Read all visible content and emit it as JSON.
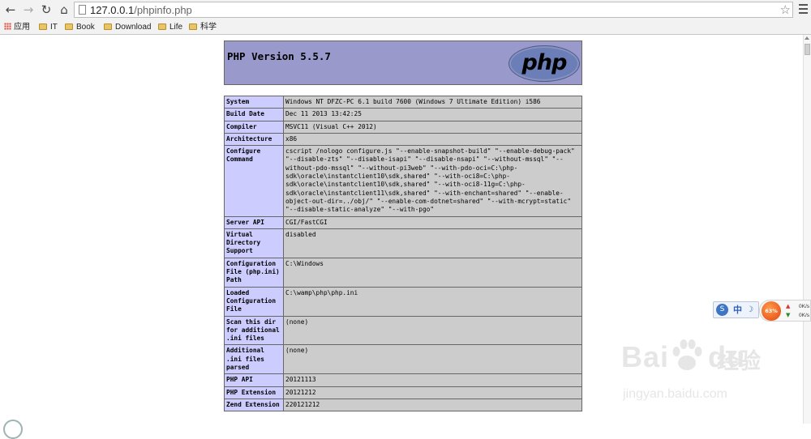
{
  "browser": {
    "url_host": "127.0.0.1",
    "url_path": "/phpinfo.php",
    "bookmarks": [
      {
        "label": "应用",
        "type": "apps"
      },
      {
        "label": "IT",
        "type": "folder"
      },
      {
        "label": "Book",
        "type": "folder"
      },
      {
        "label": "Download",
        "type": "folder"
      },
      {
        "label": "Life",
        "type": "folder"
      },
      {
        "label": "科学",
        "type": "folder"
      }
    ]
  },
  "phpinfo": {
    "version_title": "PHP Version 5.5.7",
    "logo_text": "php",
    "rows": [
      {
        "key": "System",
        "value": "Windows NT DFZC-PC 6.1 build 7600 (Windows 7 Ultimate Edition) i586"
      },
      {
        "key": "Build Date",
        "value": "Dec 11 2013 13:42:25"
      },
      {
        "key": "Compiler",
        "value": "MSVC11 (Visual C++ 2012)"
      },
      {
        "key": "Architecture",
        "value": "x86"
      },
      {
        "key": "Configure Command",
        "value": "cscript /nologo configure.js \"--enable-snapshot-build\" \"--enable-debug-pack\" \"--disable-zts\" \"--disable-isapi\" \"--disable-nsapi\" \"--without-mssql\" \"--without-pdo-mssql\" \"--without-pi3web\" \"--with-pdo-oci=C:\\php-sdk\\oracle\\instantclient10\\sdk,shared\" \"--with-oci8=C:\\php-sdk\\oracle\\instantclient10\\sdk,shared\" \"--with-oci8-11g=C:\\php-sdk\\oracle\\instantclient11\\sdk,shared\" \"--with-enchant=shared\" \"--enable-object-out-dir=../obj/\" \"--enable-com-dotnet=shared\" \"--with-mcrypt=static\" \"--disable-static-analyze\" \"--with-pgo\""
      },
      {
        "key": "Server API",
        "value": "CGI/FastCGI"
      },
      {
        "key": "Virtual Directory Support",
        "value": "disabled"
      },
      {
        "key": "Configuration File (php.ini) Path",
        "value": "C:\\Windows"
      },
      {
        "key": "Loaded Configuration File",
        "value": "C:\\wamp\\php\\php.ini"
      },
      {
        "key": "Scan this dir for additional .ini files",
        "value": "(none)"
      },
      {
        "key": "Additional .ini files parsed",
        "value": "(none)"
      },
      {
        "key": "PHP API",
        "value": "20121113"
      },
      {
        "key": "PHP Extension",
        "value": "20121212"
      },
      {
        "key": "Zend Extension",
        "value": "220121212"
      }
    ]
  },
  "widgets": {
    "ime_mode": "中",
    "cpu_percent": "63%",
    "upload_speed": "0K/s",
    "download_speed": "0K/s"
  },
  "watermark": {
    "brand": "Bai",
    "brand_suffix": "du",
    "cn": "经验",
    "url": "jingyan.baidu.com"
  }
}
